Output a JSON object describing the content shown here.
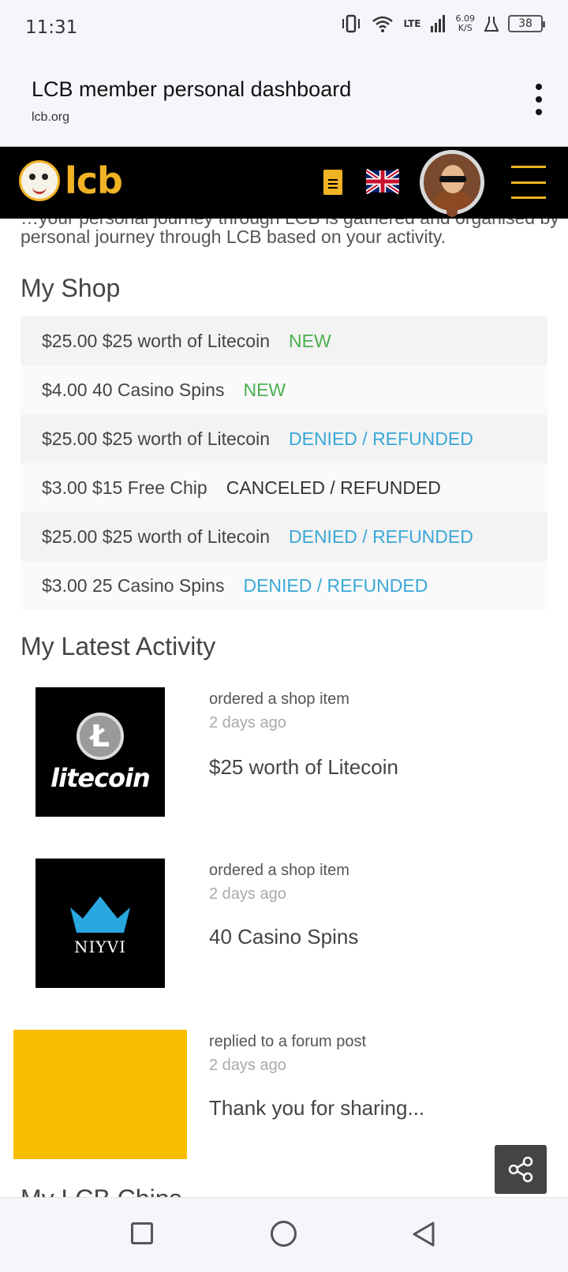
{
  "status_bar": {
    "time": "11:31",
    "net_speed_value": "6.09",
    "net_speed_unit": "K/S",
    "network": "LTE",
    "battery": "38",
    "icons": [
      "vibrate-icon",
      "wifi-icon",
      "signal-icon",
      "flask-icon",
      "battery-icon"
    ]
  },
  "browser": {
    "title": "LCB member personal dashboard",
    "url": "lcb.org",
    "menu_icon": "more-vert-icon"
  },
  "site_header": {
    "logo_text": "lcb",
    "icons": [
      "document-icon",
      "uk-flag-icon",
      "avatar",
      "hamburger-icon"
    ],
    "accent_color": "#f0b323"
  },
  "intro": {
    "cut_text": "…your personal journey through LCB is gathered and organised by",
    "text": "personal journey through LCB based on your activity."
  },
  "shop": {
    "heading": "My Shop",
    "items": [
      {
        "price": "$25.00",
        "name": "$25 worth of Litecoin",
        "status": "NEW",
        "status_type": "new"
      },
      {
        "price": "$4.00",
        "name": "40 Casino Spins",
        "status": "NEW",
        "status_type": "new"
      },
      {
        "price": "$25.00",
        "name": "$25 worth of Litecoin",
        "status": "DENIED / REFUNDED",
        "status_type": "denied"
      },
      {
        "price": "$3.00",
        "name": "$15 Free Chip",
        "status": "CANCELED / REFUNDED",
        "status_type": "canceled"
      },
      {
        "price": "$25.00",
        "name": "$25 worth of Litecoin",
        "status": "DENIED / REFUNDED",
        "status_type": "denied"
      },
      {
        "price": "$3.00",
        "name": "25 Casino Spins",
        "status": "DENIED / REFUNDED",
        "status_type": "denied"
      }
    ],
    "status_colors": {
      "new": "#4caf50",
      "denied": "#3aa8d8",
      "canceled": "#333333"
    }
  },
  "activity": {
    "heading": "My Latest Activity",
    "items": [
      {
        "action": "ordered a shop item",
        "time": "2 days ago",
        "title": "$25 worth of Litecoin",
        "thumb_label": "litecoin"
      },
      {
        "action": "ordered a shop item",
        "time": "2 days ago",
        "title": "40 Casino Spins",
        "thumb_label": "NIYVI"
      },
      {
        "action": "replied to a forum post",
        "time": "2 days ago",
        "title": "Thank you for sharing..."
      }
    ]
  },
  "next_section": {
    "heading": "My LCB Chips"
  },
  "share_icon": "share-icon",
  "nav": [
    "recents-icon",
    "home-icon",
    "back-icon"
  ]
}
